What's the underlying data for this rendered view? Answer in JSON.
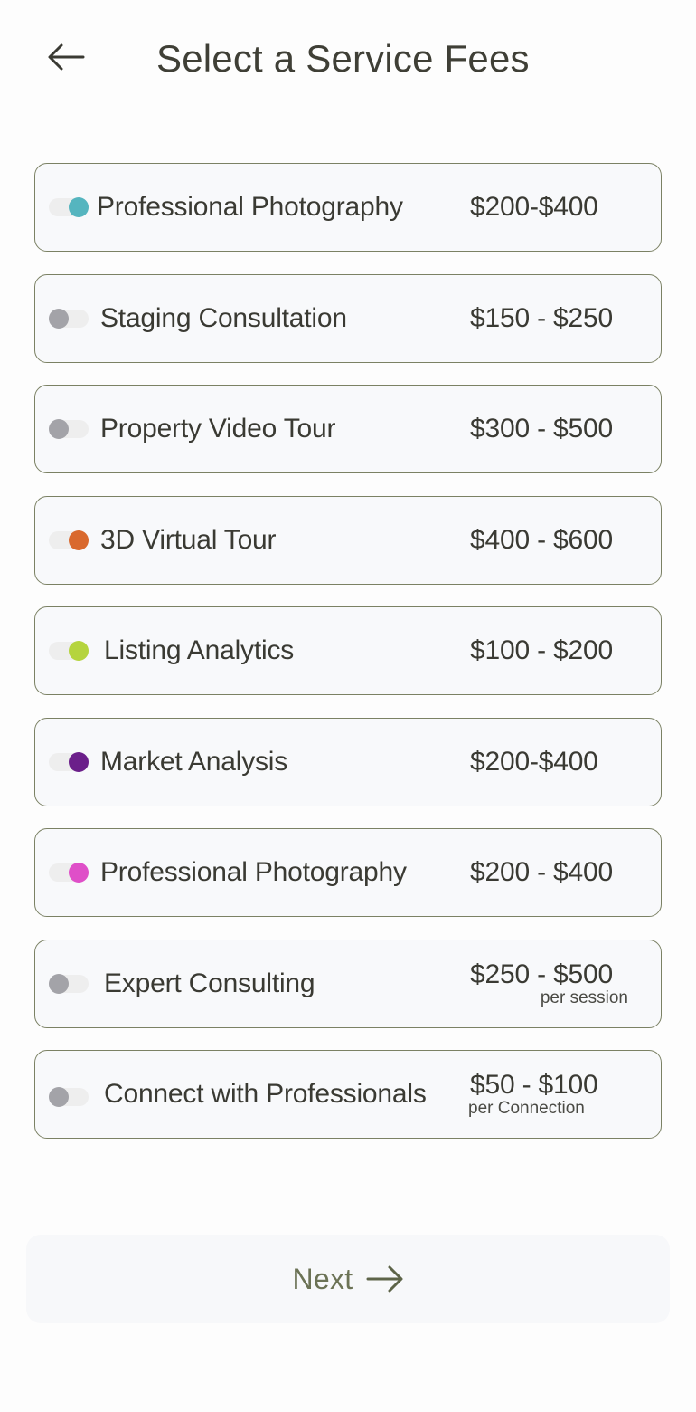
{
  "header": {
    "title": "Select a Service Fees",
    "back_icon": "arrow-left-icon"
  },
  "services": [
    {
      "name": "Professional Photography",
      "price": "$200-$400",
      "unit": "",
      "enabled": true,
      "color": "#55b5bf"
    },
    {
      "name": "Staging Consultation",
      "price": "$150 - $250",
      "unit": "",
      "enabled": false,
      "color": "#a3a3a8"
    },
    {
      "name": "Property Video Tour",
      "price": "$300 - $500",
      "unit": "",
      "enabled": false,
      "color": "#a3a3a8"
    },
    {
      "name": "3D Virtual Tour",
      "price": "$400 - $600",
      "unit": "",
      "enabled": true,
      "color": "#d9692e"
    },
    {
      "name": "Listing Analytics",
      "price": "$100 - $200",
      "unit": "",
      "enabled": true,
      "color": "#b5d43e"
    },
    {
      "name": "Market Analysis",
      "price": "$200-$400",
      "unit": "",
      "enabled": true,
      "color": "#6b1f8a"
    },
    {
      "name": "Professional Photography",
      "price": "$200 - $400",
      "unit": "",
      "enabled": true,
      "color": "#df4fc8"
    },
    {
      "name": "Expert Consulting",
      "price": "$250 - $500",
      "unit": "per session",
      "enabled": false,
      "color": "#a3a3a8"
    },
    {
      "name": "Connect with Professionals",
      "price": "$50 - $100",
      "unit": "per Connection",
      "enabled": false,
      "color": "#a3a3a8"
    }
  ],
  "footer": {
    "next_label": "Next",
    "next_icon": "arrow-right-icon"
  }
}
